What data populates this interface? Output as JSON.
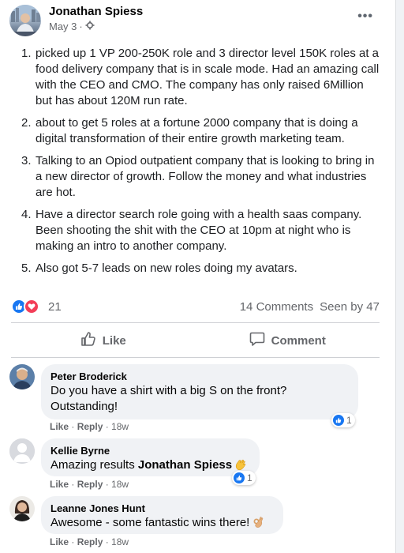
{
  "post": {
    "author": "Jonathan Spiess",
    "date": "May 3",
    "more_label": "•••",
    "items": [
      {
        "num": "1.",
        "text": "picked up 1 VP 200-250K role and 3 director level 150K roles at a food delivery company that is in scale mode. Had an amazing call with the CEO and CMO. The company has only raised 6Million but has about 120M run rate."
      },
      {
        "num": "2.",
        "text": "about to get 5 roles at a fortune 2000 company that is doing a digital transformation of their entire growth marketing team."
      },
      {
        "num": "3.",
        "text": "Talking to an Opiod outpatient company that is looking to bring in a new director of growth. Follow the money and what industries are hot."
      },
      {
        "num": "4.",
        "text": "Have a director search role going with a health saas company. Been shooting the shit with the CEO at 10pm at night who is making an intro to another company."
      },
      {
        "num": "5.",
        "text": "Also got 5-7 leads on new roles doing my avatars."
      }
    ]
  },
  "stats": {
    "reactions_count": "21",
    "comments": "14 Comments",
    "seen": "Seen by 47"
  },
  "actions": {
    "like": "Like",
    "comment": "Comment"
  },
  "comments": [
    {
      "name": "Peter Broderick",
      "text": "Do you have a shirt with a big S on the front? Outstanding!",
      "like": "Like",
      "reply": "Reply",
      "time": "18w",
      "reactions": "1"
    },
    {
      "name": "Kellie Byrne",
      "text": "Amazing results",
      "mention": "Jonathan Spiess",
      "like": "Like",
      "reply": "Reply",
      "time": "18w",
      "reactions": "1"
    },
    {
      "name": "Leanne Jones Hunt",
      "text": "Awesome - some fantastic wins there!",
      "like": "Like",
      "reply": "Reply",
      "time": "18w"
    }
  ],
  "colors": {
    "accent": "#1877f2",
    "love": "#f33e58",
    "secondary_text": "#65676b",
    "bubble": "#f0f2f5"
  }
}
